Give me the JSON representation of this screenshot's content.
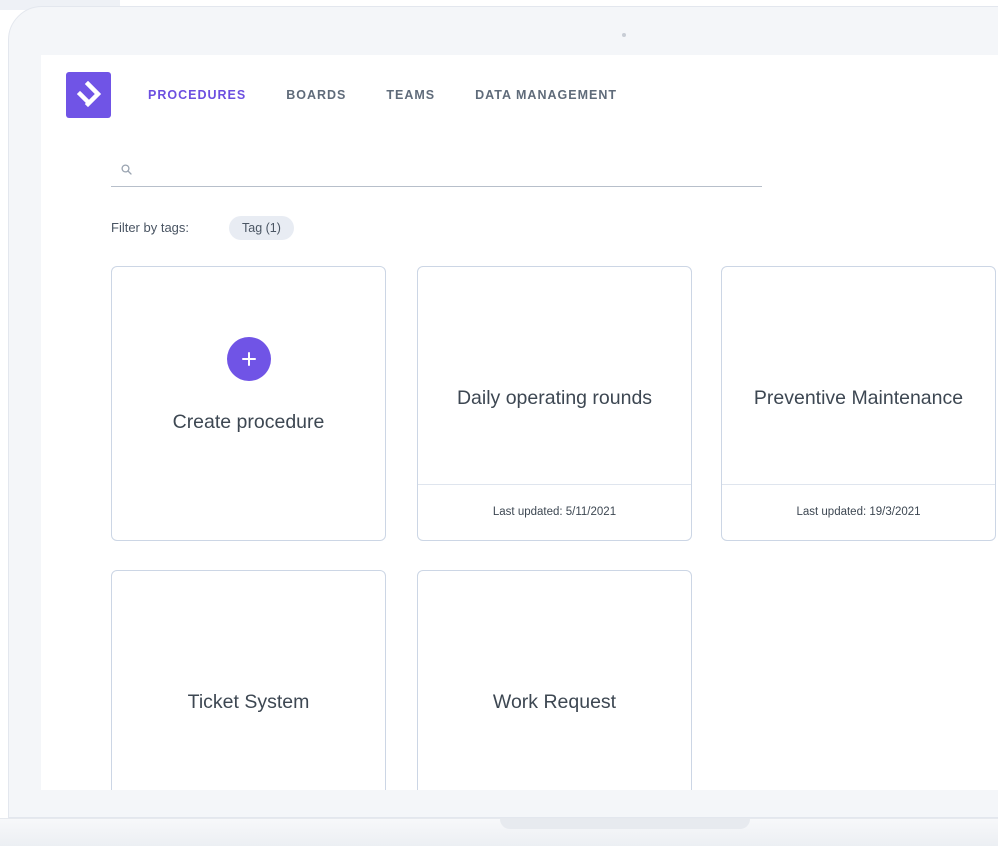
{
  "nav": {
    "items": [
      {
        "label": "PROCEDURES",
        "active": true
      },
      {
        "label": "BOARDS",
        "active": false
      },
      {
        "label": "TEAMS",
        "active": false
      },
      {
        "label": "DATA MANAGEMENT",
        "active": false
      }
    ]
  },
  "search": {
    "placeholder": "",
    "value": "",
    "icon": "search-icon"
  },
  "filter": {
    "label": "Filter by tags:",
    "tag": "Tag (1)"
  },
  "create_card": {
    "label": "Create procedure",
    "icon": "plus-icon"
  },
  "cards": [
    {
      "title": "Daily operating rounds",
      "footer": "Last updated: 5/11/2021"
    },
    {
      "title": "Preventive Maintenance",
      "footer": "Last updated: 19/3/2021"
    },
    {
      "title": "Ticket System",
      "footer": ""
    },
    {
      "title": "Work Request",
      "footer": ""
    }
  ],
  "colors": {
    "accent": "#6c4fe0",
    "logo": "#7054e6",
    "card_border": "#ccd6e5",
    "chip_bg": "#e8ecf3"
  }
}
